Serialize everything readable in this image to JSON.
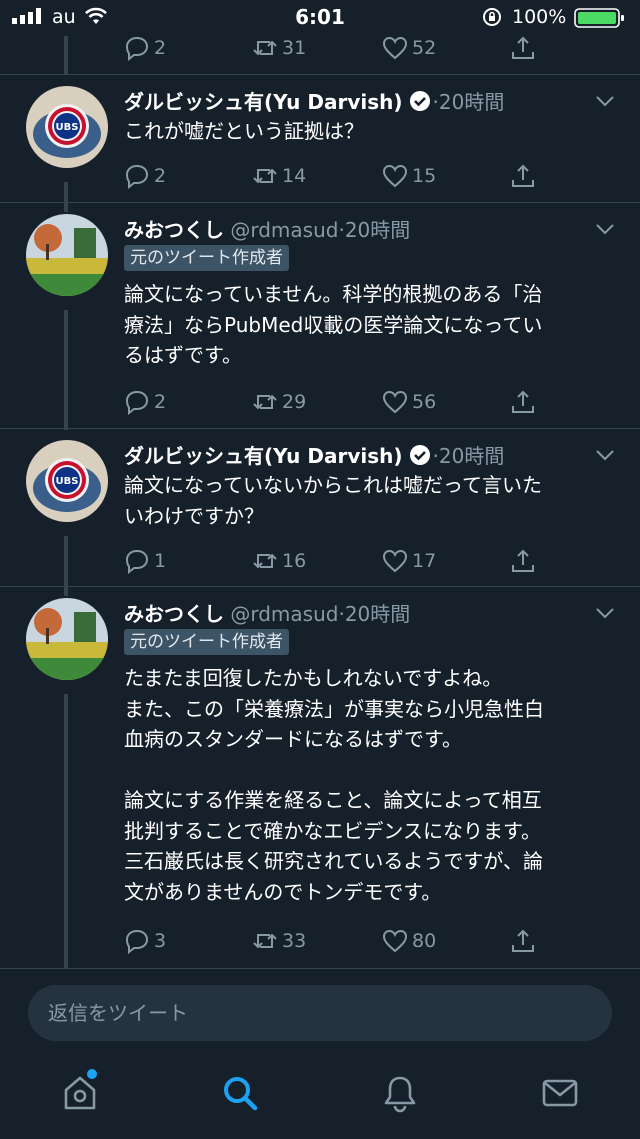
{
  "status_bar": {
    "carrier": "au",
    "time": "6:01",
    "battery": "100%"
  },
  "colors": {
    "background": "#15202b",
    "accent": "#1da1f2",
    "secondary_text": "#8899a6",
    "divider": "#38444d",
    "battery": "#4cd964"
  },
  "top_tweet_actions": {
    "reply": "2",
    "retweet": "31",
    "like": "52"
  },
  "tweets": [
    {
      "name": "ダルビッシュ有(Yu Darvish)",
      "verified": true,
      "handle": "",
      "time": "20時間",
      "badge": "",
      "avatar": "cubs-logo",
      "body": "これが嘘だという証拠は？",
      "reply": "2",
      "retweet": "14",
      "like": "15"
    },
    {
      "name": "みおつくし",
      "verified": false,
      "handle": "@rdmasud",
      "time": "20時間",
      "badge": "元のツイート作成者",
      "avatar": "park-landscape",
      "body": "論文になっていません。科学的根拠のある「治\n療法」ならPubMed収載の医学論文になってい\nるはずです。",
      "reply": "2",
      "retweet": "29",
      "like": "56"
    },
    {
      "name": "ダルビッシュ有(Yu Darvish)",
      "verified": true,
      "handle": "",
      "time": "20時間",
      "badge": "",
      "avatar": "cubs-logo",
      "body": "論文になっていないからこれは嘘だって言いた\nいわけですか？",
      "reply": "1",
      "retweet": "16",
      "like": "17"
    },
    {
      "name": "みおつくし",
      "verified": false,
      "handle": "@rdmasud",
      "time": "20時間",
      "badge": "元のツイート作成者",
      "avatar": "park-landscape",
      "body": "たまたま回復したかもしれないですよね。\nまた、この「栄養療法」が事実なら小児急性白\n血病のスタンダードになるはずです。\n\n論文にする作業を経ること、論文によって相互\n批判することで確かなエビデンスになります。\n三石巌氏は長く研究されているようですが、論\n文がありませんのでトンデモです。",
      "reply": "3",
      "retweet": "33",
      "like": "80"
    }
  ],
  "reply_box": {
    "placeholder": "返信をツイート"
  },
  "tab_bar": [
    "home-icon",
    "search-icon",
    "notifications-icon",
    "messages-icon"
  ]
}
